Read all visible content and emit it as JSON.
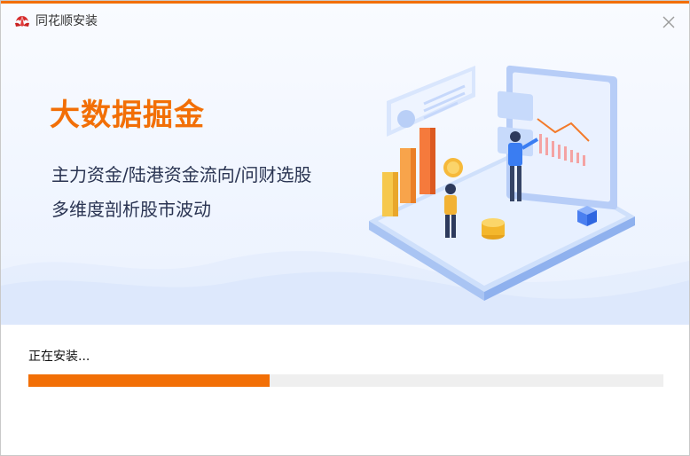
{
  "window": {
    "title": "同花顺安装"
  },
  "hero": {
    "headline": "大数据掘金",
    "line1": "主力资金/陆港资金流向/问财选股",
    "line2": "多维度剖析股市波动"
  },
  "install": {
    "status": "正在安装...",
    "progress": 0.38
  },
  "colors": {
    "accent": "#f26f06",
    "track": "#efefef",
    "text": "#2a3452"
  },
  "icons": {
    "logo": "flower-logo-icon",
    "close": "close-icon"
  }
}
